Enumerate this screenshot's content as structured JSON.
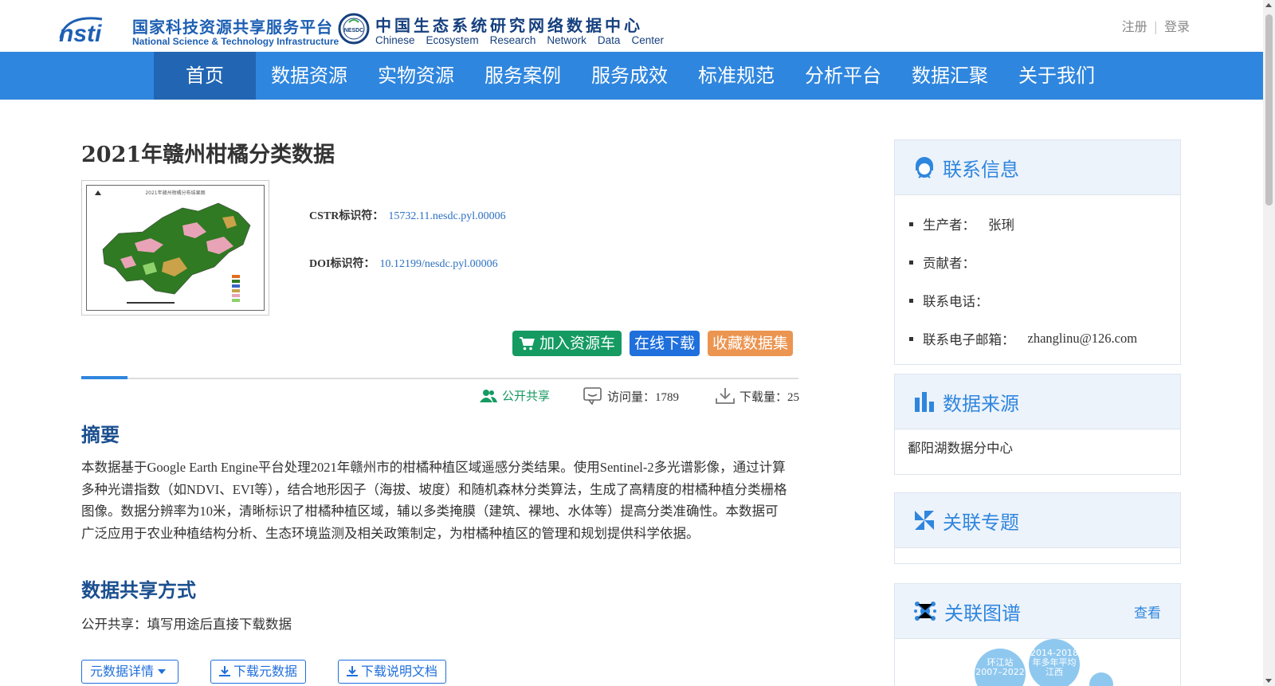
{
  "header": {
    "nsti_cn": "国家科技资源共享服务平台",
    "nsti_en": "National Science & Technology Infrastructure",
    "nsti_mark": "nsti",
    "nesdc_seal": "NESDC",
    "nesdc_cn": "中国生态系统研究网络数据中心",
    "nesdc_en": [
      "Chinese",
      "Ecosystem",
      "Research",
      "Network",
      "Data",
      "Center"
    ],
    "register": "注册",
    "login": "登录"
  },
  "nav": {
    "items": [
      {
        "label": "首页",
        "active": true
      },
      {
        "label": "数据资源"
      },
      {
        "label": "实物资源"
      },
      {
        "label": "服务案例"
      },
      {
        "label": "服务成效"
      },
      {
        "label": "标准规范"
      },
      {
        "label": "分析平台"
      },
      {
        "label": "数据汇聚"
      },
      {
        "label": "关于我们"
      }
    ]
  },
  "dataset": {
    "title": "2021年赣州柑橘分类数据",
    "thumbnail_caption": "2021年赣州柑橘分布结果图",
    "cstr_label": "CSTR标识符：",
    "cstr_value": "15732.11.nesdc.pyl.00006",
    "doi_label": "DOI标识符：",
    "doi_value": "10.12199/nesdc.pyl.00006",
    "btn_cart": "加入资源车",
    "btn_download": "在线下载",
    "btn_favorite": "收藏数据集",
    "share_status": "公开共享",
    "visits": "访问量：1789",
    "downloads": "下载量：25",
    "abstract_title": "摘要",
    "abstract": "本数据基于Google Earth Engine平台处理2021年赣州市的柑橘种植区域遥感分类结果。使用Sentinel-2多光谱影像，通过计算多种光谱指数（如NDVI、EVI等），结合地形因子（海拔、坡度）和随机森林分类算法，生成了高精度的柑橘种植分类栅格图像。数据分辨率为10米，清晰标识了柑橘种植区域，辅以多类掩膜（建筑、裸地、水体等）提高分类准确性。本数据可广泛应用于农业种植结构分析、生态环境监测及相关政策制定，为柑橘种植区的管理和规划提供科学依据。",
    "share_title": "数据共享方式",
    "share_text": "公开共享：填写用途后直接下载数据",
    "btn_metadata": "元数据详情",
    "btn_download_meta": "下载元数据",
    "btn_download_doc": "下载说明文档"
  },
  "sidebar": {
    "contact": {
      "title": "联系信息",
      "producer_label": "生产者：",
      "producer_value": "张琍",
      "contributor_label": "贡献者：",
      "phone_label": "联系电话：",
      "email_label": "联系电子邮箱：",
      "email_value": "zhanglinu@126.com"
    },
    "source": {
      "title": "数据来源",
      "value": "鄱阳湖数据分中心"
    },
    "topic": {
      "title": "关联专题"
    },
    "graph": {
      "title": "关联图谱",
      "link": "查看",
      "bubble1": "环江站2007–2022",
      "bubble2": "2014-2018年多年平均江西"
    }
  },
  "colors": {
    "nav_bg": "#2f86de",
    "nav_active": "#2266b3",
    "green_btn": "#159a62",
    "blue_btn": "#1f6fdc",
    "orange_btn": "#ec9551",
    "heading": "#1b4f8f",
    "accent": "#2f86de"
  }
}
